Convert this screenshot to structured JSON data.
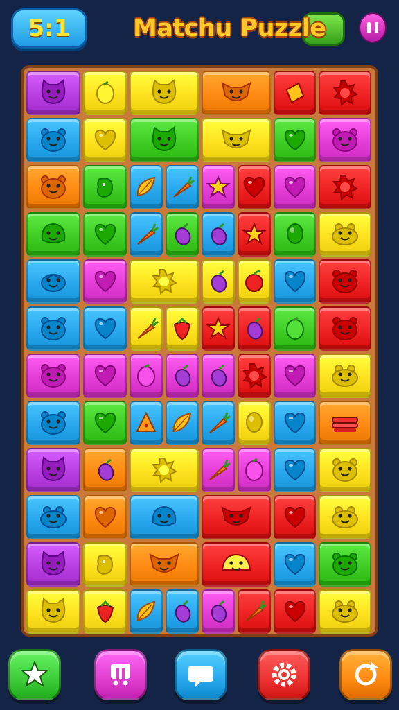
{
  "header": {
    "score": "5:1",
    "title": "Matchu Puzzle",
    "pause_icon": "pause-icon"
  },
  "palette": {
    "purple": "#b83fe0",
    "yellow": "#ffe21f",
    "orange": "#ff8a12",
    "red": "#ee2222",
    "blue": "#2aa8ee",
    "green": "#3fcc24",
    "magenta": "#e33fd6",
    "lime": "#9ee21a"
  },
  "board": {
    "columns": 8,
    "rows": 12,
    "tiles": [
      {
        "c": 0,
        "r": 0,
        "w": 2,
        "h": 1,
        "color": "purple",
        "icon": "cat-face-icon"
      },
      {
        "c": 2,
        "r": 0,
        "w": 1,
        "h": 1,
        "color": "yellow",
        "icon": "lemon-icon"
      },
      {
        "c": 3,
        "r": 0,
        "w": 2,
        "h": 1,
        "color": "yellow",
        "icon": "cat-face-icon"
      },
      {
        "c": 5,
        "r": 0,
        "w": 2,
        "h": 1,
        "color": "orange",
        "icon": "fox-face-icon"
      },
      {
        "c": 7,
        "r": 0,
        "w": 1,
        "h": 1,
        "color": "red",
        "icon": "diamond-icon"
      },
      {
        "c": 8,
        "r": 0,
        "w": 1,
        "h": 1,
        "color": "red",
        "icon": "sun-icon"
      },
      {
        "c": 0,
        "r": 1,
        "w": 2,
        "h": 1,
        "color": "blue",
        "icon": "bear-face-icon"
      },
      {
        "c": 2,
        "r": 1,
        "w": 1,
        "h": 1,
        "color": "yellow",
        "icon": "heart-icon"
      },
      {
        "c": 3,
        "r": 1,
        "w": 2,
        "h": 1,
        "color": "green",
        "icon": "cat-face-icon"
      },
      {
        "c": 5,
        "r": 1,
        "w": 2,
        "h": 1,
        "color": "yellow",
        "icon": "fox-face-icon"
      },
      {
        "c": 7,
        "r": 1,
        "w": 1,
        "h": 1,
        "color": "green",
        "icon": "heart-icon"
      },
      {
        "c": 8,
        "r": 1,
        "w": 1,
        "h": 1,
        "color": "magenta",
        "icon": "bear-face-icon"
      },
      {
        "c": 0,
        "r": 2,
        "w": 2,
        "h": 1,
        "color": "orange",
        "icon": "bear-face-icon"
      },
      {
        "c": 2,
        "r": 2,
        "w": 1,
        "h": 1,
        "color": "green",
        "icon": "blob-icon"
      },
      {
        "c": 3,
        "r": 2,
        "w": 1,
        "h": 1,
        "color": "blue",
        "icon": "leaf-icon"
      },
      {
        "c": 4,
        "r": 2,
        "w": 1,
        "h": 1,
        "color": "blue",
        "icon": "carrot-icon"
      },
      {
        "c": 5,
        "r": 2,
        "w": 1,
        "h": 1,
        "color": "magenta",
        "icon": "star-icon"
      },
      {
        "c": 6,
        "r": 2,
        "w": 1,
        "h": 1,
        "color": "red",
        "icon": "heart-icon"
      },
      {
        "c": 7,
        "r": 2,
        "w": 1,
        "h": 1,
        "color": "magenta",
        "icon": "heart-icon"
      },
      {
        "c": 8,
        "r": 2,
        "w": 1,
        "h": 1,
        "color": "red",
        "icon": "sun-icon"
      },
      {
        "c": 0,
        "r": 3,
        "w": 2,
        "h": 1,
        "color": "green",
        "icon": "blob-face-icon"
      },
      {
        "c": 2,
        "r": 3,
        "w": 1,
        "h": 1,
        "color": "green",
        "icon": "heart-icon"
      },
      {
        "c": 3,
        "r": 3,
        "w": 1,
        "h": 1,
        "color": "blue",
        "icon": "carrot-icon"
      },
      {
        "c": 4,
        "r": 3,
        "w": 1,
        "h": 1,
        "color": "green",
        "icon": "eggplant-icon"
      },
      {
        "c": 5,
        "r": 3,
        "w": 1,
        "h": 1,
        "color": "blue",
        "icon": "eggplant-icon"
      },
      {
        "c": 6,
        "r": 3,
        "w": 1,
        "h": 1,
        "color": "red",
        "icon": "star-icon"
      },
      {
        "c": 7,
        "r": 3,
        "w": 1,
        "h": 1,
        "color": "green",
        "icon": "balloon-icon"
      },
      {
        "c": 8,
        "r": 3,
        "w": 1,
        "h": 1,
        "color": "yellow",
        "icon": "frog-face-icon"
      },
      {
        "c": 0,
        "r": 4,
        "w": 2,
        "h": 1,
        "color": "blue",
        "icon": "turtle-icon"
      },
      {
        "c": 2,
        "r": 4,
        "w": 1,
        "h": 1,
        "color": "magenta",
        "icon": "heart-icon"
      },
      {
        "c": 3,
        "r": 4,
        "w": 2,
        "h": 1,
        "color": "yellow",
        "icon": "sun-icon"
      },
      {
        "c": 5,
        "r": 4,
        "w": 1,
        "h": 1,
        "color": "yellow",
        "icon": "eggplant-icon"
      },
      {
        "c": 6,
        "r": 4,
        "w": 1,
        "h": 1,
        "color": "yellow",
        "icon": "apple-icon"
      },
      {
        "c": 7,
        "r": 4,
        "w": 1,
        "h": 1,
        "color": "blue",
        "icon": "heart-icon"
      },
      {
        "c": 8,
        "r": 4,
        "w": 1,
        "h": 1,
        "color": "red",
        "icon": "bear-face-icon"
      },
      {
        "c": 0,
        "r": 5,
        "w": 2,
        "h": 1,
        "color": "blue",
        "icon": "bear-face-icon"
      },
      {
        "c": 2,
        "r": 5,
        "w": 1,
        "h": 1,
        "color": "blue",
        "icon": "heart-icon"
      },
      {
        "c": 3,
        "r": 5,
        "w": 1,
        "h": 1,
        "color": "yellow",
        "icon": "carrot-icon"
      },
      {
        "c": 4,
        "r": 5,
        "w": 1,
        "h": 1,
        "color": "yellow",
        "icon": "strawberry-icon"
      },
      {
        "c": 5,
        "r": 5,
        "w": 1,
        "h": 1,
        "color": "red",
        "icon": "star-icon"
      },
      {
        "c": 6,
        "r": 5,
        "w": 1,
        "h": 1,
        "color": "red",
        "icon": "eggplant-icon"
      },
      {
        "c": 7,
        "r": 5,
        "w": 1,
        "h": 1,
        "color": "green",
        "icon": "lemon-icon"
      },
      {
        "c": 8,
        "r": 5,
        "w": 1,
        "h": 1,
        "color": "red",
        "icon": "bear-face-icon"
      },
      {
        "c": 0,
        "r": 6,
        "w": 2,
        "h": 1,
        "color": "magenta",
        "icon": "bear-face-icon"
      },
      {
        "c": 2,
        "r": 6,
        "w": 1,
        "h": 1,
        "color": "magenta",
        "icon": "heart-icon"
      },
      {
        "c": 3,
        "r": 6,
        "w": 1,
        "h": 1,
        "color": "magenta",
        "icon": "lemon-icon"
      },
      {
        "c": 4,
        "r": 6,
        "w": 1,
        "h": 1,
        "color": "magenta",
        "icon": "eggplant-icon"
      },
      {
        "c": 5,
        "r": 6,
        "w": 1,
        "h": 1,
        "color": "magenta",
        "icon": "eggplant-icon"
      },
      {
        "c": 6,
        "r": 6,
        "w": 1,
        "h": 1,
        "color": "red",
        "icon": "sun-icon"
      },
      {
        "c": 7,
        "r": 6,
        "w": 1,
        "h": 1,
        "color": "magenta",
        "icon": "heart-icon"
      },
      {
        "c": 8,
        "r": 6,
        "w": 1,
        "h": 1,
        "color": "yellow",
        "icon": "frog-face-icon"
      },
      {
        "c": 0,
        "r": 7,
        "w": 2,
        "h": 1,
        "color": "blue",
        "icon": "bear-face-icon"
      },
      {
        "c": 2,
        "r": 7,
        "w": 1,
        "h": 1,
        "color": "green",
        "icon": "heart-icon"
      },
      {
        "c": 3,
        "r": 7,
        "w": 1,
        "h": 1,
        "color": "blue",
        "icon": "pizza-icon"
      },
      {
        "c": 4,
        "r": 7,
        "w": 1,
        "h": 1,
        "color": "blue",
        "icon": "leaf-icon"
      },
      {
        "c": 5,
        "r": 7,
        "w": 1,
        "h": 1,
        "color": "blue",
        "icon": "carrot-icon"
      },
      {
        "c": 6,
        "r": 7,
        "w": 1,
        "h": 1,
        "color": "yellow",
        "icon": "balloon-icon"
      },
      {
        "c": 7,
        "r": 7,
        "w": 1,
        "h": 1,
        "color": "blue",
        "icon": "heart-icon"
      },
      {
        "c": 8,
        "r": 7,
        "w": 1,
        "h": 1,
        "color": "orange",
        "icon": "cake-icon"
      },
      {
        "c": 0,
        "r": 8,
        "w": 2,
        "h": 1,
        "color": "purple",
        "icon": "cat-face-icon"
      },
      {
        "c": 2,
        "r": 8,
        "w": 1,
        "h": 1,
        "color": "orange",
        "icon": "eggplant-icon"
      },
      {
        "c": 3,
        "r": 8,
        "w": 2,
        "h": 1,
        "color": "yellow",
        "icon": "sun-icon"
      },
      {
        "c": 5,
        "r": 8,
        "w": 1,
        "h": 1,
        "color": "magenta",
        "icon": "carrot-icon"
      },
      {
        "c": 6,
        "r": 8,
        "w": 1,
        "h": 1,
        "color": "magenta",
        "icon": "lemon-icon"
      },
      {
        "c": 7,
        "r": 8,
        "w": 1,
        "h": 1,
        "color": "blue",
        "icon": "heart-icon"
      },
      {
        "c": 8,
        "r": 8,
        "w": 1,
        "h": 1,
        "color": "yellow",
        "icon": "bear-face-icon"
      },
      {
        "c": 0,
        "r": 9,
        "w": 2,
        "h": 1,
        "color": "blue",
        "icon": "frog-face-icon"
      },
      {
        "c": 2,
        "r": 9,
        "w": 1,
        "h": 1,
        "color": "orange",
        "icon": "heart-icon"
      },
      {
        "c": 3,
        "r": 9,
        "w": 2,
        "h": 1,
        "color": "blue",
        "icon": "blob-face-icon"
      },
      {
        "c": 5,
        "r": 9,
        "w": 2,
        "h": 1,
        "color": "red",
        "icon": "fox-face-icon"
      },
      {
        "c": 7,
        "r": 9,
        "w": 1,
        "h": 1,
        "color": "red",
        "icon": "heart-icon"
      },
      {
        "c": 8,
        "r": 9,
        "w": 1,
        "h": 1,
        "color": "yellow",
        "icon": "frog-face-icon"
      },
      {
        "c": 0,
        "r": 10,
        "w": 2,
        "h": 1,
        "color": "purple",
        "icon": "cat-face-icon"
      },
      {
        "c": 2,
        "r": 10,
        "w": 1,
        "h": 1,
        "color": "yellow",
        "icon": "blob-icon"
      },
      {
        "c": 3,
        "r": 10,
        "w": 2,
        "h": 1,
        "color": "orange",
        "icon": "fox-face-icon"
      },
      {
        "c": 5,
        "r": 10,
        "w": 2,
        "h": 1,
        "color": "red",
        "icon": "taco-face-icon"
      },
      {
        "c": 7,
        "r": 10,
        "w": 1,
        "h": 1,
        "color": "blue",
        "icon": "heart-icon"
      },
      {
        "c": 8,
        "r": 10,
        "w": 1,
        "h": 1,
        "color": "green",
        "icon": "bear-face-icon"
      },
      {
        "c": 0,
        "r": 11,
        "w": 2,
        "h": 1,
        "color": "yellow",
        "icon": "cat-face-icon"
      },
      {
        "c": 2,
        "r": 11,
        "w": 1,
        "h": 1,
        "color": "yellow",
        "icon": "strawberry-icon"
      },
      {
        "c": 3,
        "r": 11,
        "w": 1,
        "h": 1,
        "color": "blue",
        "icon": "leaf-icon"
      },
      {
        "c": 4,
        "r": 11,
        "w": 1,
        "h": 1,
        "color": "blue",
        "icon": "eggplant-icon"
      },
      {
        "c": 5,
        "r": 11,
        "w": 1,
        "h": 1,
        "color": "magenta",
        "icon": "eggplant-icon"
      },
      {
        "c": 6,
        "r": 11,
        "w": 1,
        "h": 1,
        "color": "red",
        "icon": "carrot-icon"
      },
      {
        "c": 7,
        "r": 11,
        "w": 1,
        "h": 1,
        "color": "red",
        "icon": "heart-icon"
      },
      {
        "c": 8,
        "r": 11,
        "w": 1,
        "h": 1,
        "color": "yellow",
        "icon": "frog-face-icon"
      }
    ]
  },
  "bottom_bar": {
    "buttons": [
      {
        "name": "star-button",
        "icon": "star-icon",
        "color": "#3fcc3a"
      },
      {
        "name": "boosters-button",
        "icon": "boosters-icon",
        "color": "#e23fd0"
      },
      {
        "name": "chat-button",
        "icon": "chat-bubble-icon",
        "color": "#2aa8ee"
      },
      {
        "name": "settings-button",
        "icon": "gear-icon",
        "color": "#ee3333"
      },
      {
        "name": "restart-button",
        "icon": "restart-icon",
        "color": "#ff8a12"
      }
    ]
  }
}
